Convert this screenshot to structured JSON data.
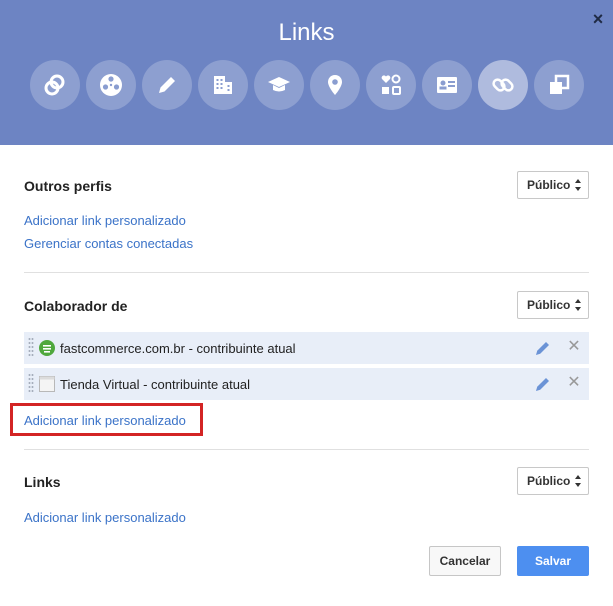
{
  "header": {
    "title": "Links",
    "close_label": "×",
    "icons": [
      {
        "name": "circles-icon",
        "active": false
      },
      {
        "name": "film-reel-icon",
        "active": false
      },
      {
        "name": "pencil-icon",
        "active": false
      },
      {
        "name": "building-icon",
        "active": false
      },
      {
        "name": "graduation-cap-icon",
        "active": false
      },
      {
        "name": "map-pin-icon",
        "active": false
      },
      {
        "name": "relationship-icon",
        "active": false
      },
      {
        "name": "contact-card-icon",
        "active": false
      },
      {
        "name": "link-chain-icon",
        "active": true
      },
      {
        "name": "overlapping-squares-icon",
        "active": false
      }
    ]
  },
  "sections": {
    "other_profiles": {
      "title": "Outros perfis",
      "visibility": "Público",
      "add_link": "Adicionar link personalizado",
      "manage_accounts": "Gerenciar contas conectadas"
    },
    "contributor": {
      "title": "Colaborador de",
      "visibility": "Público",
      "items": [
        {
          "label": "fastcommerce.com.br - contribuinte atual",
          "favicon": "fastcommerce-favicon"
        },
        {
          "label": "Tienda Virtual - contribuinte atual",
          "favicon": "page-favicon"
        }
      ],
      "add_link": "Adicionar link personalizado"
    },
    "links": {
      "title": "Links",
      "visibility": "Público",
      "add_link": "Adicionar link personalizado"
    }
  },
  "footer": {
    "cancel_label": "Cancelar",
    "save_label": "Salvar"
  },
  "colors": {
    "header_bg": "#6d84c3",
    "link": "#3b73c8",
    "row_bg": "#e8eef8",
    "primary_button": "#4d8ff0",
    "highlight": "#d32424"
  }
}
